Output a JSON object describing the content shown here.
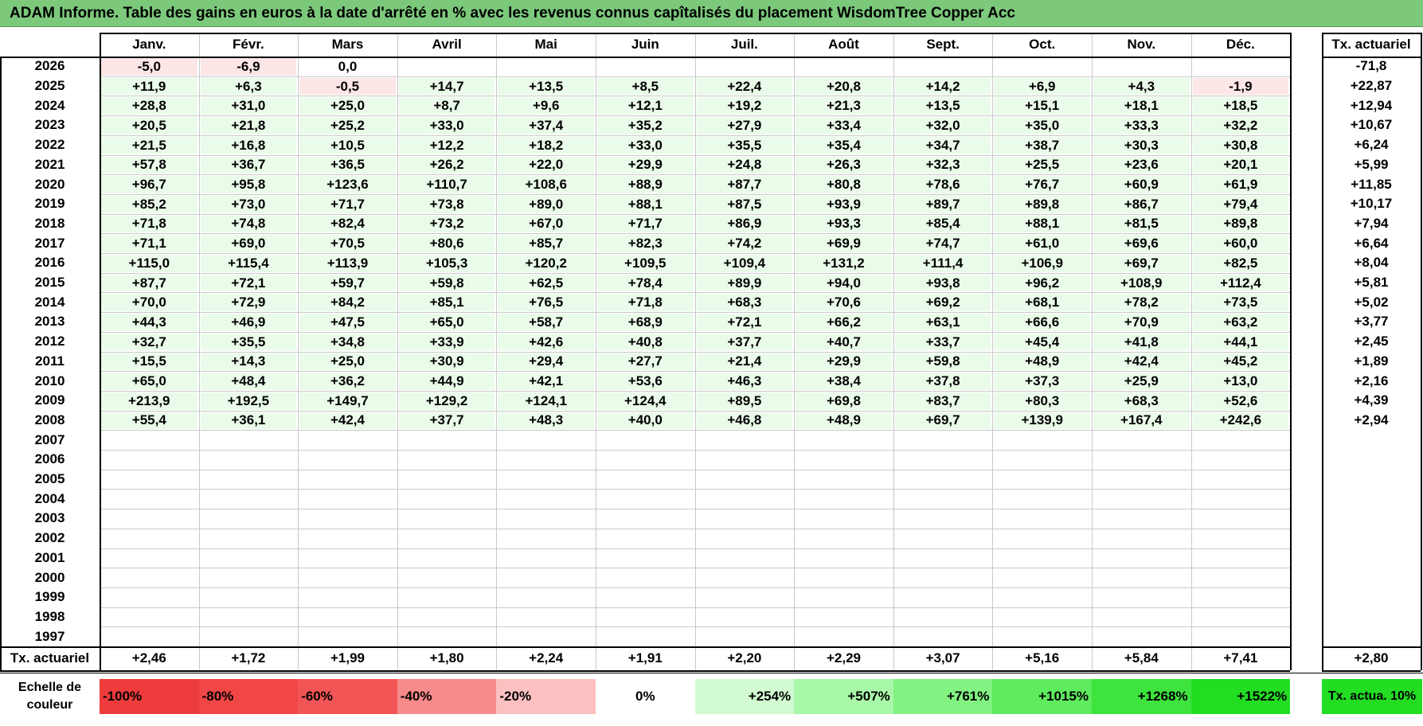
{
  "title": "ADAM Informe. Table des gains en euros à la date d'arrêté en % avec les revenus connus capîtalisés du placement WisdomTree Copper Acc",
  "months": [
    "Janv.",
    "Févr.",
    "Mars",
    "Avril",
    "Mai",
    "Juin",
    "Juil.",
    "Août",
    "Sept.",
    "Oct.",
    "Nov.",
    "Déc."
  ],
  "rate_header": "Tx. actuariel",
  "rows": [
    {
      "year": "2026",
      "values": [
        "-5,0",
        "-6,9",
        "0,0",
        "",
        "",
        "",
        "",
        "",
        "",
        "",
        "",
        ""
      ],
      "rate": "-71,8"
    },
    {
      "year": "2025",
      "values": [
        "+11,9",
        "+6,3",
        "-0,5",
        "+14,7",
        "+13,5",
        "+8,5",
        "+22,4",
        "+20,8",
        "+14,2",
        "+6,9",
        "+4,3",
        "-1,9"
      ],
      "rate": "+22,87"
    },
    {
      "year": "2024",
      "values": [
        "+28,8",
        "+31,0",
        "+25,0",
        "+8,7",
        "+9,6",
        "+12,1",
        "+19,2",
        "+21,3",
        "+13,5",
        "+15,1",
        "+18,1",
        "+18,5"
      ],
      "rate": "+12,94"
    },
    {
      "year": "2023",
      "values": [
        "+20,5",
        "+21,8",
        "+25,2",
        "+33,0",
        "+37,4",
        "+35,2",
        "+27,9",
        "+33,4",
        "+32,0",
        "+35,0",
        "+33,3",
        "+32,2"
      ],
      "rate": "+10,67"
    },
    {
      "year": "2022",
      "values": [
        "+21,5",
        "+16,8",
        "+10,5",
        "+12,2",
        "+18,2",
        "+33,0",
        "+35,5",
        "+35,4",
        "+34,7",
        "+38,7",
        "+30,3",
        "+30,8"
      ],
      "rate": "+6,24"
    },
    {
      "year": "2021",
      "values": [
        "+57,8",
        "+36,7",
        "+36,5",
        "+26,2",
        "+22,0",
        "+29,9",
        "+24,8",
        "+26,3",
        "+32,3",
        "+25,5",
        "+23,6",
        "+20,1"
      ],
      "rate": "+5,99"
    },
    {
      "year": "2020",
      "values": [
        "+96,7",
        "+95,8",
        "+123,6",
        "+110,7",
        "+108,6",
        "+88,9",
        "+87,7",
        "+80,8",
        "+78,6",
        "+76,7",
        "+60,9",
        "+61,9"
      ],
      "rate": "+11,85"
    },
    {
      "year": "2019",
      "values": [
        "+85,2",
        "+73,0",
        "+71,7",
        "+73,8",
        "+89,0",
        "+88,1",
        "+87,5",
        "+93,9",
        "+89,7",
        "+89,8",
        "+86,7",
        "+79,4"
      ],
      "rate": "+10,17"
    },
    {
      "year": "2018",
      "values": [
        "+71,8",
        "+74,8",
        "+82,4",
        "+73,2",
        "+67,0",
        "+71,7",
        "+86,9",
        "+93,3",
        "+85,4",
        "+88,1",
        "+81,5",
        "+89,8"
      ],
      "rate": "+7,94"
    },
    {
      "year": "2017",
      "values": [
        "+71,1",
        "+69,0",
        "+70,5",
        "+80,6",
        "+85,7",
        "+82,3",
        "+74,2",
        "+69,9",
        "+74,7",
        "+61,0",
        "+69,6",
        "+60,0"
      ],
      "rate": "+6,64"
    },
    {
      "year": "2016",
      "values": [
        "+115,0",
        "+115,4",
        "+113,9",
        "+105,3",
        "+120,2",
        "+109,5",
        "+109,4",
        "+131,2",
        "+111,4",
        "+106,9",
        "+69,7",
        "+82,5"
      ],
      "rate": "+8,04"
    },
    {
      "year": "2015",
      "values": [
        "+87,7",
        "+72,1",
        "+59,7",
        "+59,8",
        "+62,5",
        "+78,4",
        "+89,9",
        "+94,0",
        "+93,8",
        "+96,2",
        "+108,9",
        "+112,4"
      ],
      "rate": "+5,81"
    },
    {
      "year": "2014",
      "values": [
        "+70,0",
        "+72,9",
        "+84,2",
        "+85,1",
        "+76,5",
        "+71,8",
        "+68,3",
        "+70,6",
        "+69,2",
        "+68,1",
        "+78,2",
        "+73,5"
      ],
      "rate": "+5,02"
    },
    {
      "year": "2013",
      "values": [
        "+44,3",
        "+46,9",
        "+47,5",
        "+65,0",
        "+58,7",
        "+68,9",
        "+72,1",
        "+66,2",
        "+63,1",
        "+66,6",
        "+70,9",
        "+63,2"
      ],
      "rate": "+3,77"
    },
    {
      "year": "2012",
      "values": [
        "+32,7",
        "+35,5",
        "+34,8",
        "+33,9",
        "+42,6",
        "+40,8",
        "+37,7",
        "+40,7",
        "+33,7",
        "+45,4",
        "+41,8",
        "+44,1"
      ],
      "rate": "+2,45"
    },
    {
      "year": "2011",
      "values": [
        "+15,5",
        "+14,3",
        "+25,0",
        "+30,9",
        "+29,4",
        "+27,7",
        "+21,4",
        "+29,9",
        "+59,8",
        "+48,9",
        "+42,4",
        "+45,2"
      ],
      "rate": "+1,89"
    },
    {
      "year": "2010",
      "values": [
        "+65,0",
        "+48,4",
        "+36,2",
        "+44,9",
        "+42,1",
        "+53,6",
        "+46,3",
        "+38,4",
        "+37,8",
        "+37,3",
        "+25,9",
        "+13,0"
      ],
      "rate": "+2,16"
    },
    {
      "year": "2009",
      "values": [
        "+213,9",
        "+192,5",
        "+149,7",
        "+129,2",
        "+124,1",
        "+124,4",
        "+89,5",
        "+69,8",
        "+83,7",
        "+80,3",
        "+68,3",
        "+52,6"
      ],
      "rate": "+4,39"
    },
    {
      "year": "2008",
      "values": [
        "+55,4",
        "+36,1",
        "+42,4",
        "+37,7",
        "+48,3",
        "+40,0",
        "+46,8",
        "+48,9",
        "+69,7",
        "+139,9",
        "+167,4",
        "+242,6"
      ],
      "rate": "+2,94"
    },
    {
      "year": "2007",
      "values": [
        "",
        "",
        "",
        "",
        "",
        "",
        "",
        "",
        "",
        "",
        "",
        ""
      ],
      "rate": ""
    },
    {
      "year": "2006",
      "values": [
        "",
        "",
        "",
        "",
        "",
        "",
        "",
        "",
        "",
        "",
        "",
        ""
      ],
      "rate": ""
    },
    {
      "year": "2005",
      "values": [
        "",
        "",
        "",
        "",
        "",
        "",
        "",
        "",
        "",
        "",
        "",
        ""
      ],
      "rate": ""
    },
    {
      "year": "2004",
      "values": [
        "",
        "",
        "",
        "",
        "",
        "",
        "",
        "",
        "",
        "",
        "",
        ""
      ],
      "rate": ""
    },
    {
      "year": "2003",
      "values": [
        "",
        "",
        "",
        "",
        "",
        "",
        "",
        "",
        "",
        "",
        "",
        ""
      ],
      "rate": ""
    },
    {
      "year": "2002",
      "values": [
        "",
        "",
        "",
        "",
        "",
        "",
        "",
        "",
        "",
        "",
        "",
        ""
      ],
      "rate": ""
    },
    {
      "year": "2001",
      "values": [
        "",
        "",
        "",
        "",
        "",
        "",
        "",
        "",
        "",
        "",
        "",
        ""
      ],
      "rate": ""
    },
    {
      "year": "2000",
      "values": [
        "",
        "",
        "",
        "",
        "",
        "",
        "",
        "",
        "",
        "",
        "",
        ""
      ],
      "rate": ""
    },
    {
      "year": "1999",
      "values": [
        "",
        "",
        "",
        "",
        "",
        "",
        "",
        "",
        "",
        "",
        "",
        ""
      ],
      "rate": ""
    },
    {
      "year": "1998",
      "values": [
        "",
        "",
        "",
        "",
        "",
        "",
        "",
        "",
        "",
        "",
        "",
        ""
      ],
      "rate": ""
    },
    {
      "year": "1997",
      "values": [
        "",
        "",
        "",
        "",
        "",
        "",
        "",
        "",
        "",
        "",
        "",
        ""
      ],
      "rate": ""
    }
  ],
  "footer": {
    "label": "Tx. actuariel",
    "values": [
      "+2,46",
      "+1,72",
      "+1,99",
      "+1,80",
      "+2,24",
      "+1,91",
      "+2,20",
      "+2,29",
      "+3,07",
      "+5,16",
      "+5,84",
      "+7,41"
    ],
    "rate": "+2,80"
  },
  "legend": {
    "title": "Echelle de couleur",
    "items": [
      {
        "label": "-100%",
        "color": "#ee3b3b"
      },
      {
        "label": "-80%",
        "color": "#f04646"
      },
      {
        "label": "-60%",
        "color": "#f25555"
      },
      {
        "label": "-40%",
        "color": "#f78a8a"
      },
      {
        "label": "-20%",
        "color": "#fcc0c0"
      },
      {
        "label": "0%",
        "color": "#ffffff"
      },
      {
        "label": "+254%",
        "color": "#d2fbd2"
      },
      {
        "label": "+507%",
        "color": "#a9f7a9"
      },
      {
        "label": "+761%",
        "color": "#82f282"
      },
      {
        "label": "+1015%",
        "color": "#5eeb5e"
      },
      {
        "label": "+1268%",
        "color": "#3ee33e"
      },
      {
        "label": "+1522%",
        "color": "#22dd22"
      }
    ],
    "rate_label": "Tx. actua. 10%",
    "rate_color": "#22dd22"
  },
  "cell_colors": {
    "positive": "#eafbea",
    "negative": "#fde6e6",
    "empty": "#ffffff"
  }
}
